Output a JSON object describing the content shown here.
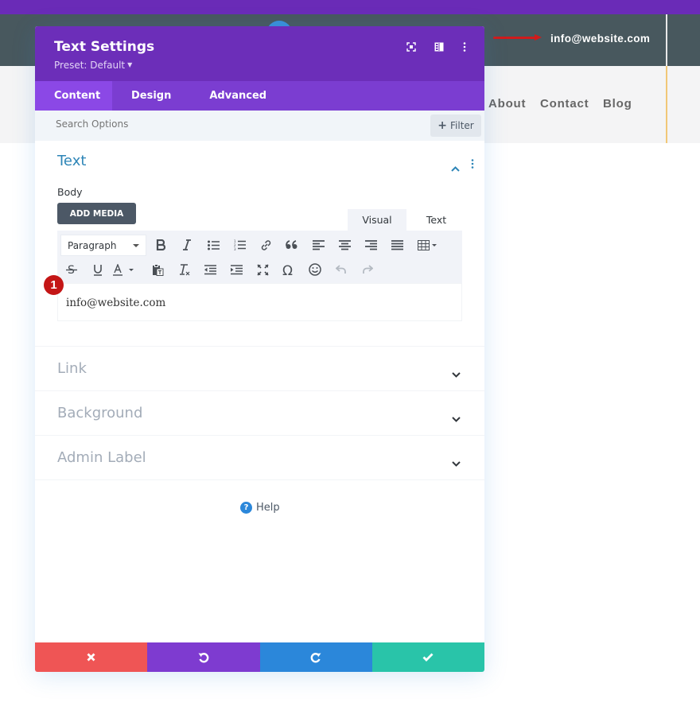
{
  "website": {
    "top_email": "info@website.com",
    "nav": [
      "About",
      "Contact",
      "Blog"
    ]
  },
  "modal": {
    "title": "Text Settings",
    "preset": "Preset: Default",
    "header_icons": [
      "expand-icon",
      "split-view-icon",
      "more-options-icon"
    ],
    "tabs": [
      {
        "label": "Content",
        "active": true
      },
      {
        "label": "Design",
        "active": false
      },
      {
        "label": "Advanced",
        "active": false
      }
    ],
    "search": {
      "placeholder": "Search Options",
      "value": ""
    },
    "filter_label": "Filter",
    "sections": {
      "text": {
        "title": "Text",
        "expanded": true,
        "body_label": "Body",
        "add_media_label": "ADD MEDIA",
        "editor_tabs": {
          "visual": "Visual",
          "text": "Text"
        },
        "format_select": "Paragraph",
        "toolbar_row1": [
          "bold",
          "italic",
          "bullet-list",
          "numbered-list",
          "link",
          "blockquote",
          "align-left",
          "align-center",
          "align-right",
          "align-justify",
          "table"
        ],
        "toolbar_row2": [
          "strikethrough",
          "underline",
          "text-color",
          "paste-as-text",
          "clear-formatting",
          "outdent",
          "indent",
          "fullscreen",
          "special-character",
          "emoji",
          "undo",
          "redo"
        ],
        "content": "info@website.com"
      },
      "collapsed": [
        {
          "title": "Link"
        },
        {
          "title": "Background"
        },
        {
          "title": "Admin Label"
        }
      ]
    },
    "help_label": "Help",
    "annotation_badge": "1",
    "footer": {
      "buttons": [
        "cancel",
        "undo",
        "redo",
        "save"
      ],
      "colors": {
        "cancel": "#ef5555",
        "undo": "#7e3bd0",
        "redo": "#2b87da",
        "save": "#29c4a9"
      }
    },
    "colors": {
      "header": "#6c2eb9",
      "tabs": "#7b3dd1",
      "active_tab": "#8b48e6",
      "section_title": "#2d85b7"
    }
  }
}
